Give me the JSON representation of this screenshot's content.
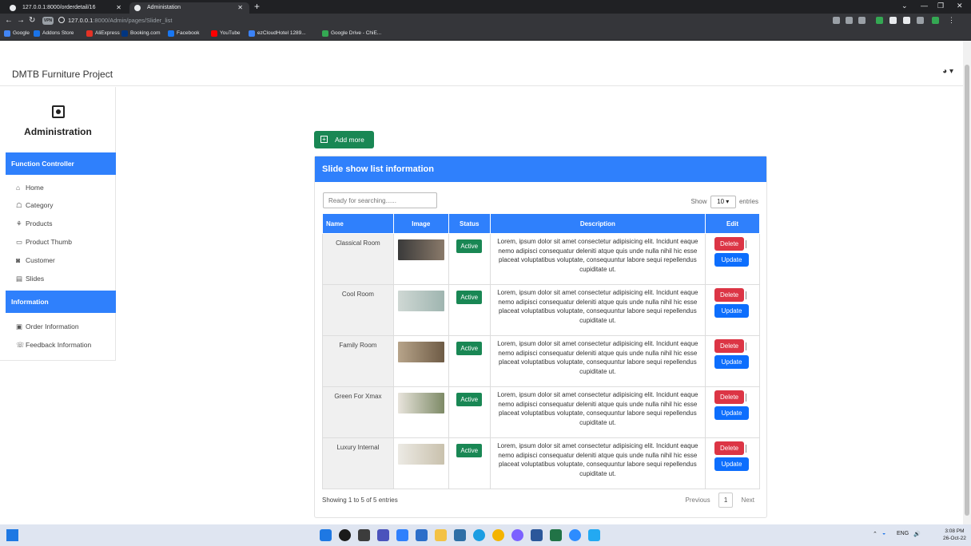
{
  "browser": {
    "tabs": [
      {
        "title": "127.0.0.1:8000/orderdetail/16"
      },
      {
        "title": "Administation"
      }
    ],
    "url_host": "127.0.0.1",
    "url_rest": ":8000/Admin/pages/Slider_list",
    "vpn_label": "VPN",
    "bookmarks": [
      {
        "label": "Google",
        "color": "#4285f4"
      },
      {
        "label": "Addons Store",
        "color": "#1a73e8"
      },
      {
        "label": "AliExpress",
        "color": "#e43225"
      },
      {
        "label": "Booking.com",
        "color": "#003580"
      },
      {
        "label": "Facebook",
        "color": "#1877f2"
      },
      {
        "label": "YouTube",
        "color": "#ff0000"
      },
      {
        "label": "ezCloudHotel 1289...",
        "color": "#3b82f6"
      },
      {
        "label": "Google Drive - ChiE...",
        "color": "#34a853"
      }
    ]
  },
  "app": {
    "brand": "DMTB Furniture Project",
    "admin_title": "Administration"
  },
  "sidebar": {
    "section1": "Function Controller",
    "items1": [
      {
        "label": "Home",
        "icon": "⌂"
      },
      {
        "label": "Category",
        "icon": "☖"
      },
      {
        "label": "Products",
        "icon": "⚘"
      },
      {
        "label": "Product Thumb",
        "icon": "▭"
      },
      {
        "label": "Customer",
        "icon": "◙"
      },
      {
        "label": "Slides",
        "icon": "▤"
      }
    ],
    "section2": "Information",
    "items2": [
      {
        "label": "Order Information",
        "icon": "▣"
      },
      {
        "label": "Feedback Information",
        "icon": "☏"
      }
    ]
  },
  "main": {
    "add_label": "Add more",
    "card_title": "Slide show list information",
    "search_placeholder": "Ready for searching......",
    "show_label": "Show",
    "show_value": "10",
    "entries_label": "entries",
    "columns": [
      "Name",
      "Image",
      "Status",
      "Description",
      "Edit"
    ],
    "rows": [
      {
        "name": "Classical Room",
        "status": "Active",
        "thumb": [
          "#3a3a3a",
          "#8a7a6a"
        ]
      },
      {
        "name": "Cool Room",
        "status": "Active",
        "thumb": [
          "#cfd8d4",
          "#9fb5b0"
        ]
      },
      {
        "name": "Family Room",
        "status": "Active",
        "thumb": [
          "#b7a48a",
          "#6e5b45"
        ]
      },
      {
        "name": "Green For Xmax",
        "status": "Active",
        "thumb": [
          "#e8e4dc",
          "#7d8a66"
        ]
      },
      {
        "name": "Luxury Internal",
        "status": "Active",
        "thumb": [
          "#eceae4",
          "#c9c1ad"
        ]
      }
    ],
    "description": "Lorem, ipsum dolor sit amet consectetur adipisicing elit. Incidunt eaque nemo adipisci consequatur deleniti atque quis unde nulla nihil hic esse placeat voluptatibus voluptate, consequuntur labore sequi repellendus cupiditate ut.",
    "delete_label": "Delete",
    "update_label": "Update",
    "showing": "Showing 1 to 5 of 5 entries",
    "pager": {
      "previous": "Previous",
      "page": "1",
      "next": "Next"
    }
  },
  "taskbar": {
    "lang": "ENG",
    "time": "3:08 PM",
    "date": "26-Oct-22"
  }
}
